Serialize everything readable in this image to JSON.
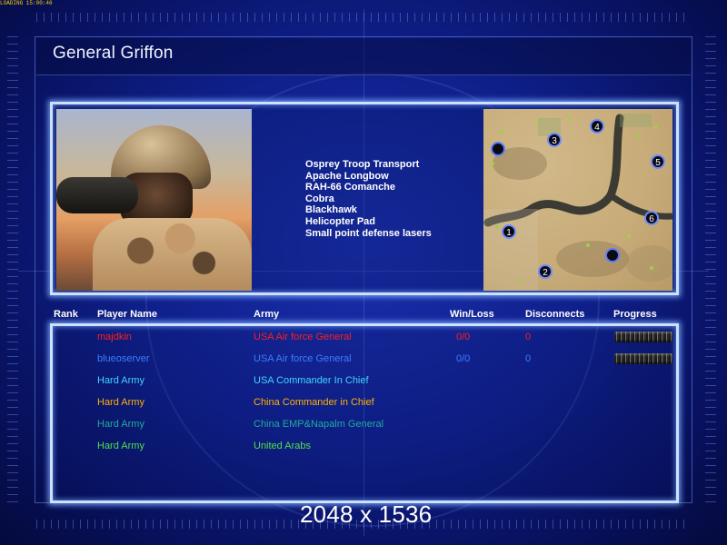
{
  "topbar": {
    "text": "LOADING 15:00:46"
  },
  "header": {
    "title": "General Griffon"
  },
  "general": {
    "units": [
      "Osprey Troop Transport",
      "Apache Longbow",
      "RAH-66 Comanche",
      "Cobra",
      "Blackhawk",
      "Helicopter Pad",
      "Small point defense lasers"
    ]
  },
  "map": {
    "start_positions": [
      "1",
      "2",
      "3",
      "4",
      "5",
      "6"
    ]
  },
  "table": {
    "headers": {
      "rank": "Rank",
      "player_name": "Player Name",
      "army": "Army",
      "win_loss": "Win/Loss",
      "disconnects": "Disconnects",
      "progress": "Progress"
    },
    "rows": [
      {
        "player": "majdkin",
        "army": "USA Air force General",
        "win_loss": "0/0",
        "disconnects": "0",
        "color": "#ff1e1e",
        "progress": true
      },
      {
        "player": "blueoserver",
        "army": "USA Air force General",
        "win_loss": "0/0",
        "disconnects": "0",
        "color": "#3d7dff",
        "progress": true
      },
      {
        "player": "Hard Army",
        "army": "USA Commander In Chief",
        "win_loss": "",
        "disconnects": "",
        "color": "#3fd6ff",
        "progress": false
      },
      {
        "player": "Hard Army",
        "army": "China Commander in Chief",
        "win_loss": "",
        "disconnects": "",
        "color": "#ffb000",
        "progress": false
      },
      {
        "player": "Hard Army",
        "army": "China EMP&Napalm General",
        "win_loss": "",
        "disconnects": "",
        "color": "#1fae9a",
        "progress": false
      },
      {
        "player": "Hard Army",
        "army": "United Arabs",
        "win_loss": "",
        "disconnects": "",
        "color": "#4fe04f",
        "progress": false
      }
    ]
  },
  "footer": {
    "resolution": "2048 x 1536"
  }
}
